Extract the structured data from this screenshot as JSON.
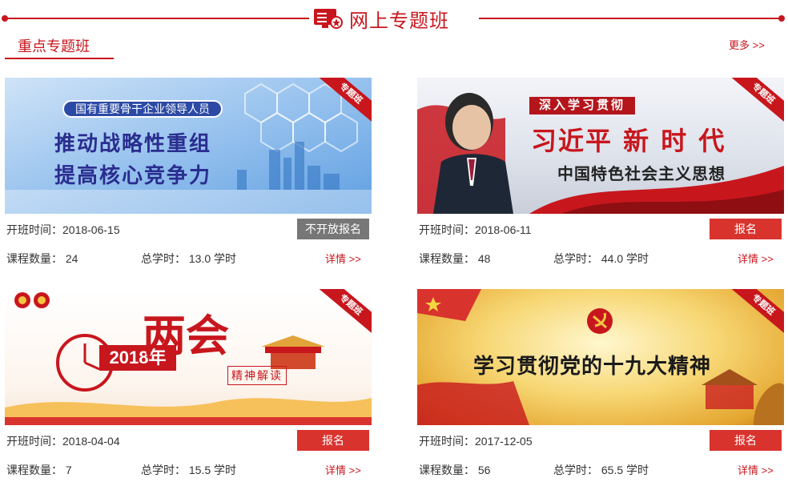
{
  "header": {
    "title": "网上专题班",
    "icon": "screen-icon",
    "accent_color": "#c8161d"
  },
  "section": {
    "title": "重点专题班",
    "more_label": "更多 >>"
  },
  "card_badge": "专题班",
  "labels": {
    "start_prefix": "开班时间：",
    "count_prefix": "课程数量：",
    "hours_prefix": "总学时：",
    "hours_unit": "学时",
    "detail": "详情 >>"
  },
  "courses": [
    {
      "banner_subtitle": "国有重要骨干企业领导人员",
      "banner_line1": "推动战略性重组",
      "banner_line2": "提高核心竞争力",
      "date": "2018-06-15",
      "count": "24",
      "hours": "13.0",
      "button": "不开放报名",
      "button_state": "closed"
    },
    {
      "banner_subtitle": "深入学习贯彻",
      "banner_line1": "习近平 新 时 代",
      "banner_line2": "中国特色社会主义思想",
      "date": "2018-06-11",
      "count": "48",
      "hours": "44.0",
      "button": "报名",
      "button_state": "open"
    },
    {
      "banner_subtitle": "2018年",
      "banner_line1": "两会",
      "banner_line2": "精神解读",
      "date": "2018-04-04",
      "count": "7",
      "hours": "15.5",
      "button": "报名",
      "button_state": "open"
    },
    {
      "banner_subtitle": "",
      "banner_line1": "学习贯彻党的十九大精神",
      "banner_line2": "",
      "date": "2017-12-05",
      "count": "56",
      "hours": "65.5",
      "button": "报名",
      "button_state": "open"
    }
  ]
}
